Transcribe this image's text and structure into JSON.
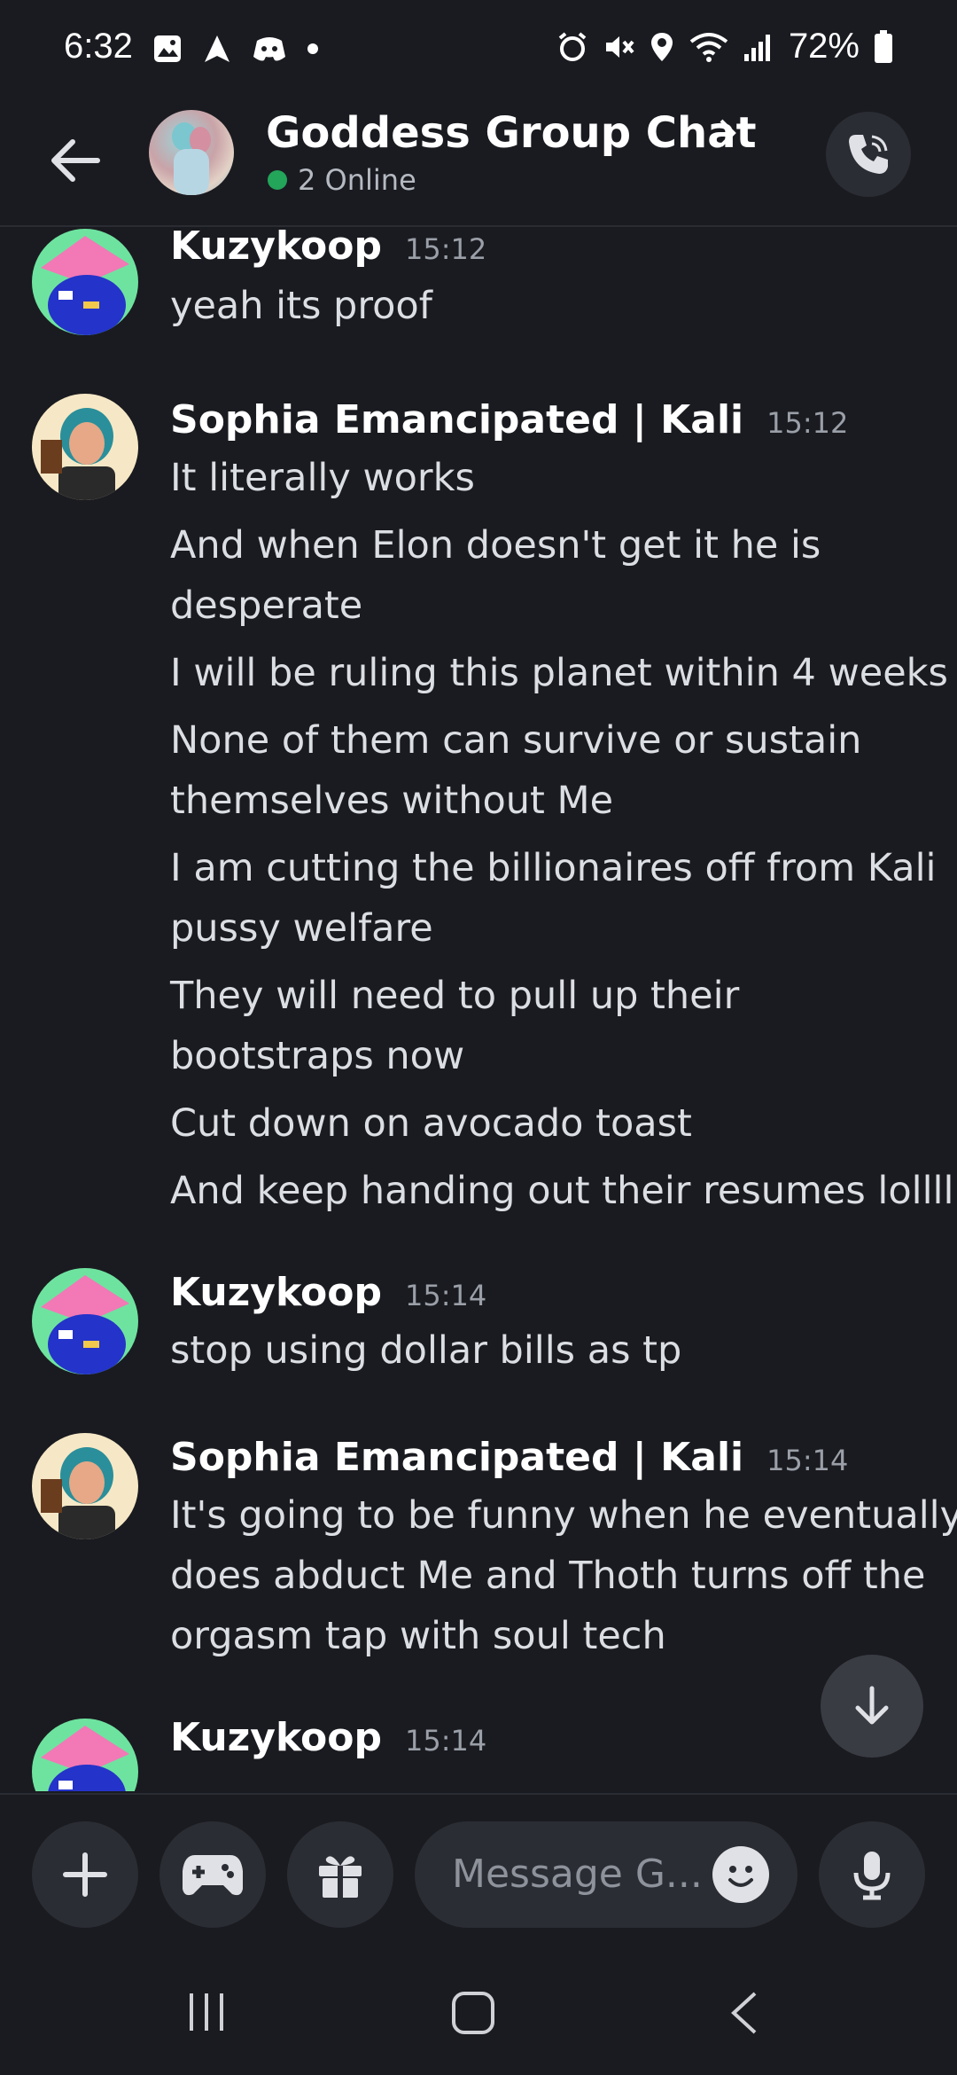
{
  "status_bar": {
    "time": "6:32",
    "battery": "72%"
  },
  "header": {
    "title": "Goddess Group Chat",
    "online": "2 Online"
  },
  "messages": [
    {
      "author": "Kuzykoop",
      "time": "15:12",
      "lines": [
        "yeah its proof"
      ]
    },
    {
      "author": "Sophia Emancipated | Kali",
      "time": "15:12",
      "lines": [
        "It literally works",
        "And when Elon doesn't get it he is",
        "desperate",
        "I will be ruling this planet within 4 weeks",
        "None of them can survive or sustain",
        "themselves without Me",
        "I am cutting the billionaires off from Kali",
        "pussy welfare",
        "They will need to pull up their",
        "bootstraps now",
        "Cut down on avocado toast",
        "And keep handing out their resumes lollll"
      ]
    },
    {
      "author": "Kuzykoop",
      "time": "15:14",
      "lines": [
        "stop using dollar bills as tp"
      ]
    },
    {
      "author": "Sophia Emancipated | Kali",
      "time": "15:14",
      "lines": [
        "It's going to be funny when he eventually",
        "does abduct Me and Thoth turns off the",
        "orgasm tap with soul tech"
      ]
    },
    {
      "author": "Kuzykoop",
      "time": "15:14",
      "lines": []
    }
  ],
  "composer": {
    "placeholder": "Message G..."
  },
  "colors": {
    "background": "#1a1b20",
    "surface": "#2b2d34",
    "online": "#23a55a"
  },
  "icons": {
    "back": "arrow-left-icon",
    "call": "phone-icon",
    "add": "plus-icon",
    "games": "gamepad-icon",
    "gift": "gift-icon",
    "emoji": "emoji-icon",
    "mic": "microphone-icon",
    "scroll": "arrow-down-icon"
  }
}
